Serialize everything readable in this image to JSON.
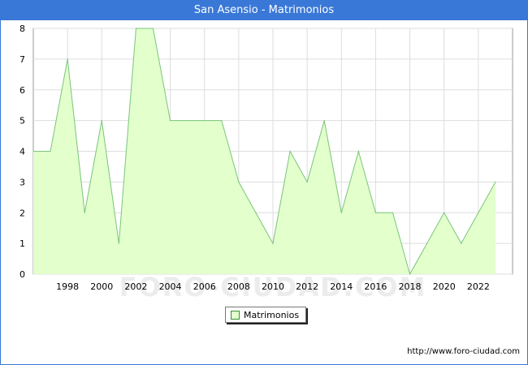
{
  "header": {
    "title": "San Asensio - Matrimonios"
  },
  "footer": {
    "url": "http://www.foro-ciudad.com"
  },
  "watermark": "FORO-CIUDAD.COM",
  "chart_data": {
    "type": "area",
    "title": "San Asensio - Matrimonios",
    "xlabel": "",
    "ylabel": "",
    "x": [
      1996,
      1997,
      1998,
      1999,
      2000,
      2001,
      2002,
      2003,
      2004,
      2005,
      2006,
      2007,
      2008,
      2009,
      2010,
      2011,
      2012,
      2013,
      2014,
      2015,
      2016,
      2017,
      2018,
      2019,
      2020,
      2021,
      2022,
      2023
    ],
    "series": [
      {
        "name": "Matrimonios",
        "values": [
          4,
          4,
          7,
          2,
          5,
          1,
          8,
          8,
          5,
          5,
          5,
          5,
          3,
          2,
          1,
          4,
          3,
          5,
          2,
          4,
          2,
          2,
          0,
          1,
          2,
          1,
          2,
          3
        ]
      }
    ],
    "xlim": [
      1996,
      2024
    ],
    "ylim": [
      0,
      8
    ],
    "x_ticks": [
      "1998",
      "2000",
      "2002",
      "2004",
      "2006",
      "2008",
      "2010",
      "2012",
      "2014",
      "2016",
      "2018",
      "2020",
      "2022"
    ],
    "y_ticks": [
      "0",
      "1",
      "2",
      "3",
      "4",
      "5",
      "6",
      "7",
      "8"
    ],
    "grid": true,
    "legend": "bottom-center",
    "colors": {
      "fill": "#e2ffcc",
      "line": "#7bc47b",
      "header": "#3a78d8"
    }
  }
}
